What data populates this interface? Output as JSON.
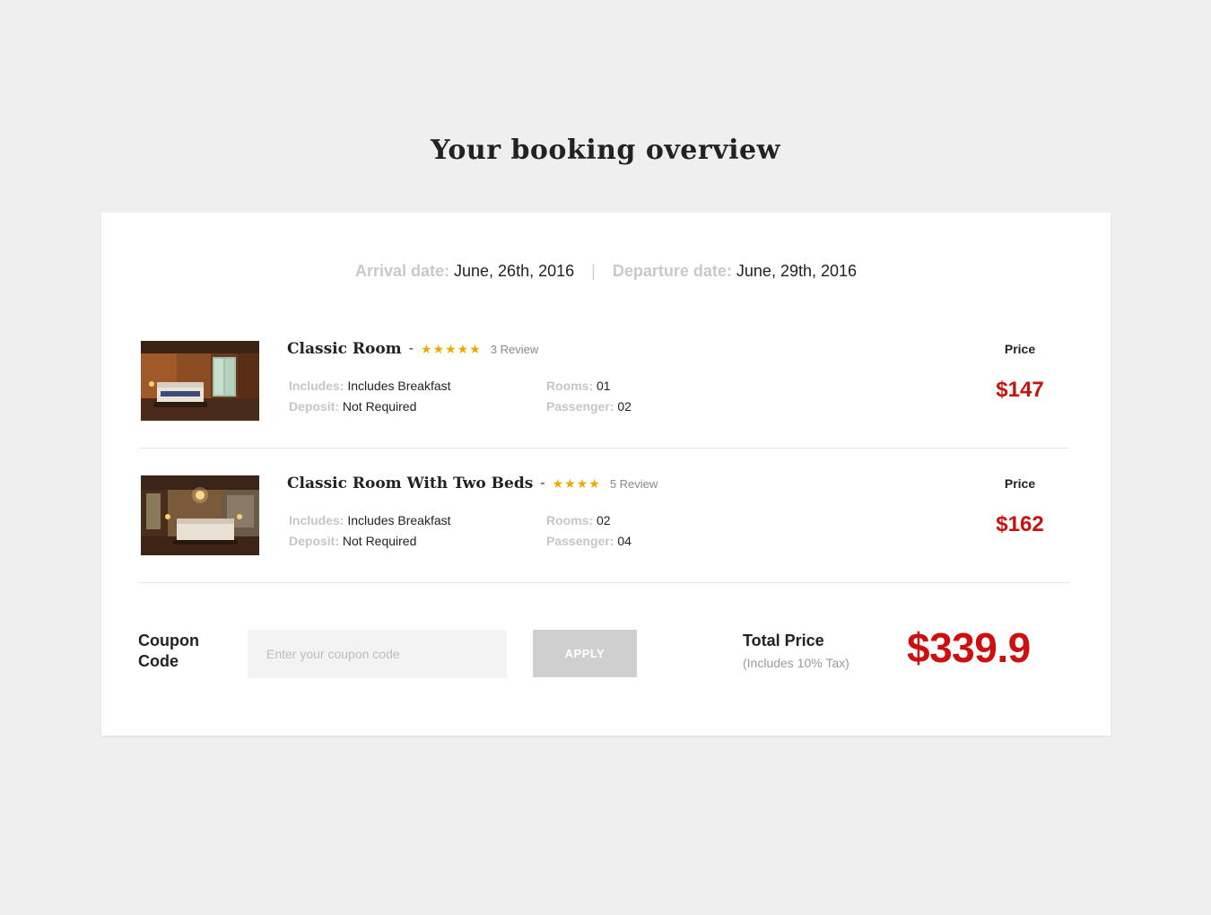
{
  "page": {
    "title": "Your booking overview"
  },
  "dates": {
    "arrival_label": "Arrival date:",
    "arrival_value": "June, 26th, 2016",
    "separator": "|",
    "departure_label": "Departure date:",
    "departure_value": "June, 29th, 2016"
  },
  "rooms": [
    {
      "name": "Classic Room",
      "dash": "-",
      "stars": "★★★★★",
      "rating": 5,
      "reviews": "3 Review",
      "includes_label": "Includes:",
      "includes_value": "Includes Breakfast",
      "deposit_label": "Deposit:",
      "deposit_value": "Not Required",
      "rooms_label": "Rooms:",
      "rooms_value": "01",
      "passenger_label": "Passenger:",
      "passenger_value": "02",
      "price_label": "Price",
      "price": "$147"
    },
    {
      "name": "Classic Room With Two Beds",
      "dash": "-",
      "stars": "★★★★",
      "rating": 4,
      "reviews": "5 Review",
      "includes_label": "Includes:",
      "includes_value": "Includes Breakfast",
      "deposit_label": "Deposit:",
      "deposit_value": "Not Required",
      "rooms_label": "Rooms:",
      "rooms_value": "02",
      "passenger_label": "Passenger:",
      "passenger_value": "04",
      "price_label": "Price",
      "price": "$162"
    }
  ],
  "coupon": {
    "label": "Coupon Code",
    "placeholder": "Enter your coupon code",
    "button": "APPLY"
  },
  "total": {
    "label": "Total Price",
    "note": "(Includes 10% Tax)",
    "value": "$339.9"
  },
  "colors": {
    "accent": "#cc1010",
    "star": "#f0a800",
    "background": "#efefef"
  }
}
